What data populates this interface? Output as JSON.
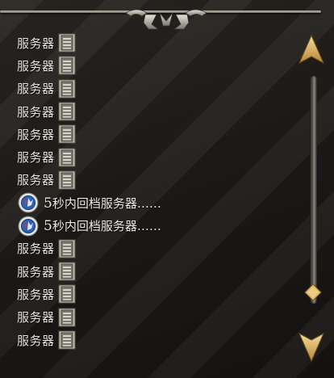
{
  "list": {
    "items": [
      {
        "type": "server",
        "label": "服务器"
      },
      {
        "type": "server",
        "label": "服务器"
      },
      {
        "type": "server",
        "label": "服务器"
      },
      {
        "type": "server",
        "label": "服务器"
      },
      {
        "type": "server",
        "label": "服务器"
      },
      {
        "type": "server",
        "label": "服务器"
      },
      {
        "type": "server",
        "label": "服务器"
      },
      {
        "type": "save",
        "num": "5",
        "text": "秒内回档服务器……"
      },
      {
        "type": "save",
        "num": "5",
        "text": "秒内回档服务器……"
      },
      {
        "type": "server",
        "label": "服务器"
      },
      {
        "type": "server",
        "label": "服务器"
      },
      {
        "type": "server",
        "label": "服务器"
      },
      {
        "type": "server",
        "label": "服务器"
      },
      {
        "type": "server",
        "label": "服务器"
      }
    ]
  },
  "scrollbar": {
    "position": 0.95
  },
  "icons": {
    "server": "server-icon",
    "save": "save-badge-icon",
    "up": "arrow-up-icon",
    "down": "arrow-down-icon"
  },
  "colors": {
    "accent_gold": "#e0b765",
    "text": "#e6e3dc",
    "badge_blue": "#2d62b5"
  }
}
